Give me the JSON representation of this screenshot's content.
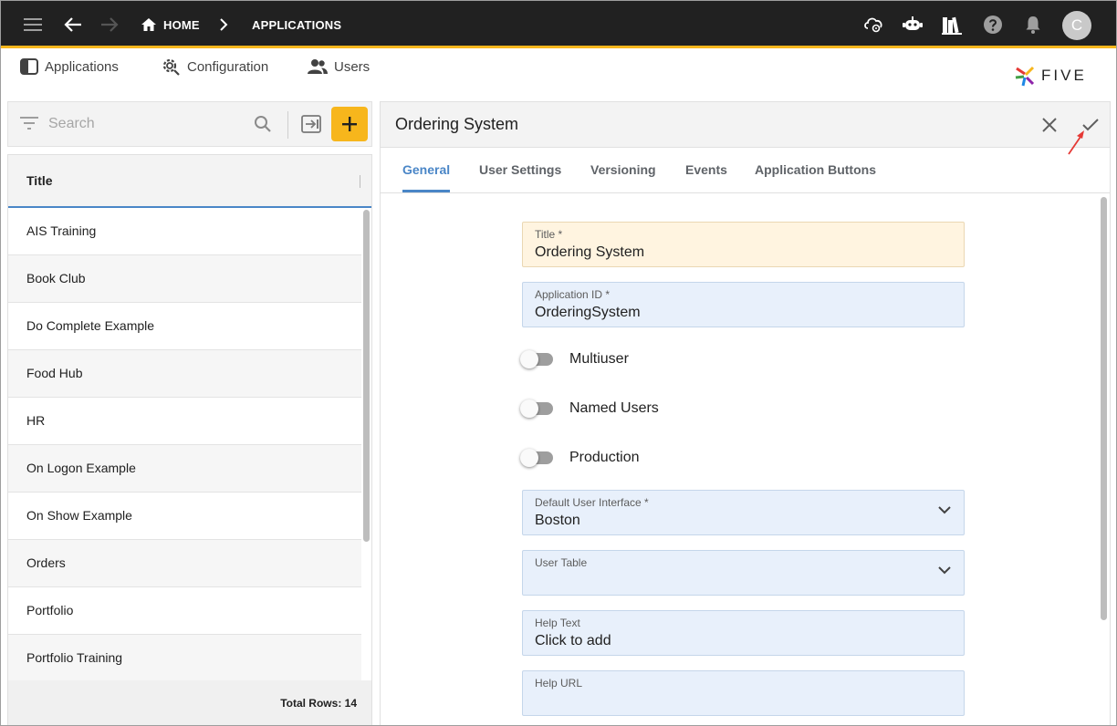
{
  "topbar": {
    "home_label": "HOME",
    "section_label": "APPLICATIONS",
    "avatar_letter": "C"
  },
  "subnav": {
    "items": [
      {
        "label": "Applications",
        "icon": "applications-icon"
      },
      {
        "label": "Configuration",
        "icon": "gear-icon"
      },
      {
        "label": "Users",
        "icon": "users-icon"
      }
    ],
    "logo_text": "FIVE"
  },
  "list_panel": {
    "search_placeholder": "Search",
    "column_header": "Title",
    "rows": [
      "AIS Training",
      "Book Club",
      "Do Complete Example",
      "Food Hub",
      "HR",
      "On Logon Example",
      "On Show Example",
      "Orders",
      "Portfolio",
      "Portfolio Training"
    ],
    "total_rows_label": "Total Rows: 14"
  },
  "form": {
    "title": "Ordering System",
    "tabs": [
      {
        "label": "General",
        "active": true
      },
      {
        "label": "User Settings",
        "active": false
      },
      {
        "label": "Versioning",
        "active": false
      },
      {
        "label": "Events",
        "active": false
      },
      {
        "label": "Application Buttons",
        "active": false
      }
    ],
    "fields": {
      "title": {
        "label": "Title *",
        "value": "Ordering System"
      },
      "app_id": {
        "label": "Application ID *",
        "value": "OrderingSystem"
      },
      "multiuser": {
        "label": "Multiuser",
        "on": false
      },
      "named_users": {
        "label": "Named Users",
        "on": false
      },
      "production": {
        "label": "Production",
        "on": false
      },
      "default_ui": {
        "label": "Default User Interface *",
        "value": "Boston"
      },
      "user_table": {
        "label": "User Table",
        "value": ""
      },
      "help_text": {
        "label": "Help Text",
        "value": "Click to add"
      },
      "help_url": {
        "label": "Help URL",
        "value": ""
      }
    }
  },
  "colors": {
    "topbar": "#212121",
    "accent": "#f7b61c",
    "tab_active": "#4a86c7",
    "field_blue": "#e8f0fb",
    "field_yellow": "#fff4e0",
    "annotation_arrow": "#e53935"
  }
}
